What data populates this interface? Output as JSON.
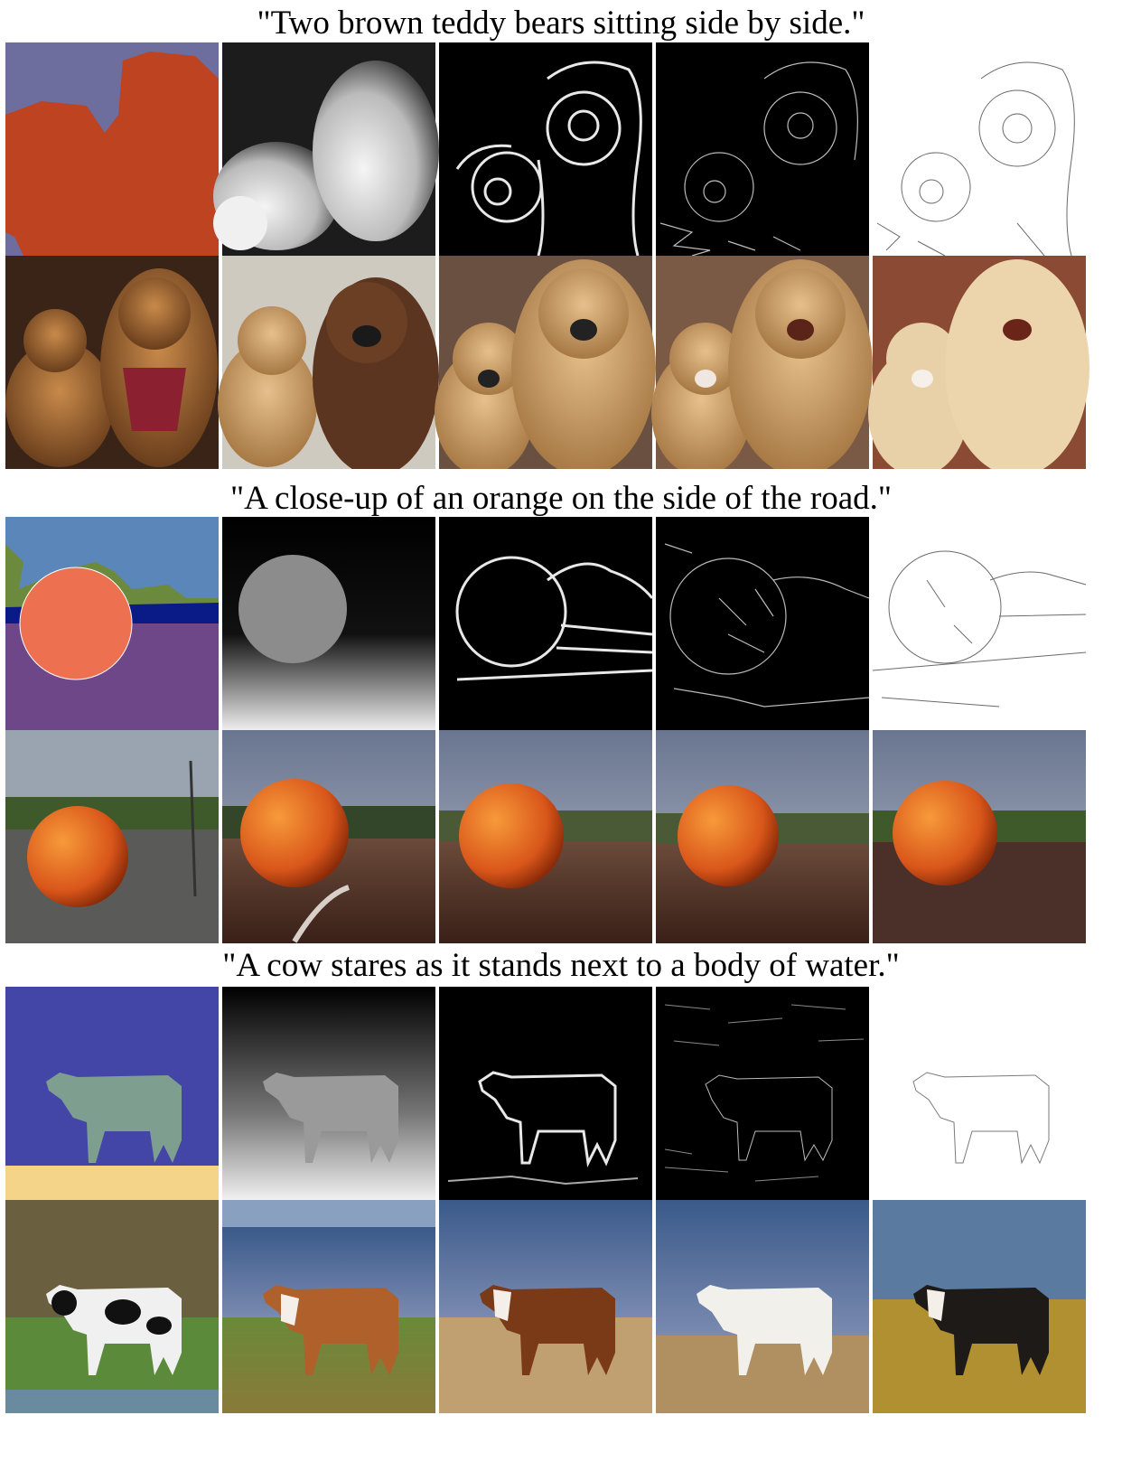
{
  "figure": {
    "panels": [
      {
        "caption": "\"Two brown teddy bears sitting side by side.\"",
        "condition_row": [
          "segmentation",
          "depth",
          "hed-edges",
          "canny-edges",
          "sketch"
        ],
        "generated_row": [
          "image-1",
          "image-2",
          "image-3",
          "image-4",
          "image-5"
        ]
      },
      {
        "caption": "\"A close-up of an orange on the side of the road.\"",
        "condition_row": [
          "segmentation",
          "depth",
          "hed-edges",
          "canny-edges",
          "sketch"
        ],
        "generated_row": [
          "image-1",
          "image-2",
          "image-3",
          "image-4",
          "image-5"
        ]
      },
      {
        "caption": "\"A cow stares as it stands next to a body of water.\"",
        "condition_row": [
          "segmentation",
          "depth",
          "hed-edges",
          "canny-edges",
          "sketch"
        ],
        "generated_row": [
          "image-1",
          "image-2",
          "image-3",
          "image-4",
          "image-5"
        ]
      }
    ]
  },
  "colors": {
    "bear_seg_bg": "#6d6e9e",
    "bear_seg_fg": "#be4320",
    "orange_seg_sky": "#5b86ba",
    "orange_seg_tree": "#6c8a3d",
    "orange_seg_water": "#0a1a86",
    "orange_seg_ground": "#6e4789",
    "orange_seg_fruit": "#ed7050",
    "cow_seg_bg": "#4346a6",
    "cow_seg_cow": "#7e9e90",
    "cow_seg_sand": "#f3d488"
  }
}
